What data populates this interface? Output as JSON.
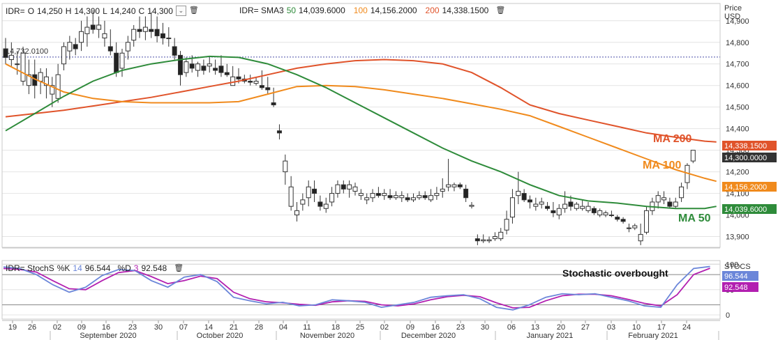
{
  "header": {
    "quote": {
      "ric": "IDR=",
      "o_label": "O",
      "o": "14,250",
      "h_label": "H",
      "h": "14,300",
      "l_label": "L",
      "l": "14,240",
      "c_label": "C",
      "c": "14,300"
    },
    "sma": {
      "label": "IDR= SMA3",
      "p1": "50",
      "v1": "14,039.6000",
      "p2": "100",
      "v2": "14,156.2000",
      "p3": "200",
      "v3": "14,338.1500"
    },
    "stoch": {
      "label": "IDR= StochS",
      "k_label": "%K",
      "k_period": "14",
      "k_val": "96.544",
      "d_label": "%D",
      "d_period": "3",
      "d_val": "92.548"
    }
  },
  "axis": {
    "price_title": "Price",
    "price_unit": "USD",
    "price_ticks": [
      "14,900",
      "14,800",
      "14,700",
      "14,600",
      "14,500",
      "14,400",
      "14,300",
      "14,200",
      "14,100",
      "14,000",
      "13,900"
    ],
    "stoch_title": "STOCS",
    "stoch_ticks": [
      "100",
      "50",
      "0"
    ],
    "day_labels": [
      "19",
      "26",
      "02",
      "09",
      "16",
      "23",
      "30",
      "07",
      "14",
      "21",
      "28",
      "04",
      "11",
      "18",
      "25",
      "02",
      "09",
      "16",
      "23",
      "30",
      "06",
      "13",
      "20",
      "27",
      "03",
      "10",
      "17",
      "24"
    ],
    "month_labels": [
      "September 2020",
      "October 2020",
      "November 2020",
      "December 2020",
      "January 2021",
      "February 2021"
    ]
  },
  "tags": {
    "ma200": "14,338.1500",
    "close": "14,300.0000",
    "ma100": "14,156.2000",
    "ma50": "14,039.6000",
    "k": "96.544",
    "d": "92.548"
  },
  "annotations": {
    "ma200": "MA 200",
    "ma100": "MA 100",
    "ma50": "MA 50",
    "stoch": "Stochastic overbought",
    "ref_label": "14,732.0100"
  },
  "colors": {
    "ma50": "#2e8b3a",
    "ma100": "#f08a1c",
    "ma200": "#e0532a",
    "k": "#6b86d9",
    "d": "#b21fb0",
    "close_tag": "#333333",
    "ref_line": "#4a4fa8"
  },
  "chart_data": {
    "type": "candlestick",
    "price_ylim": [
      13850,
      14980
    ],
    "reference_level": 14732,
    "candles": [
      [
        14770,
        14820,
        14700,
        14730
      ],
      [
        14720,
        14800,
        14690,
        14740
      ],
      [
        14700,
        14760,
        14650,
        14700
      ],
      [
        14620,
        14780,
        14600,
        14750
      ],
      [
        14600,
        14720,
        14560,
        14650
      ],
      [
        14650,
        14720,
        14540,
        14600
      ],
      [
        14620,
        14680,
        14560,
        14660
      ],
      [
        14600,
        14680,
        14540,
        14640
      ],
      [
        14560,
        14640,
        14500,
        14600
      ],
      [
        14540,
        14700,
        14520,
        14650
      ],
      [
        14700,
        14800,
        14670,
        14780
      ],
      [
        14760,
        14830,
        14720,
        14800
      ],
      [
        14790,
        14820,
        14740,
        14770
      ],
      [
        14800,
        14900,
        14760,
        14850
      ],
      [
        14840,
        14920,
        14780,
        14870
      ],
      [
        14880,
        14950,
        14840,
        14860
      ],
      [
        14860,
        14920,
        14820,
        14880
      ],
      [
        14820,
        14900,
        14780,
        14840
      ],
      [
        14780,
        14860,
        14740,
        14760
      ],
      [
        14750,
        14800,
        14640,
        14660
      ],
      [
        14680,
        14770,
        14640,
        14750
      ],
      [
        14760,
        14830,
        14720,
        14800
      ],
      [
        14810,
        14880,
        14780,
        14860
      ],
      [
        14860,
        14920,
        14820,
        14850
      ],
      [
        14850,
        14920,
        14810,
        14870
      ],
      [
        14860,
        14940,
        14820,
        14850
      ],
      [
        14860,
        14920,
        14800,
        14830
      ],
      [
        14840,
        14890,
        14790,
        14820
      ],
      [
        14820,
        14870,
        14780,
        14820
      ],
      [
        14780,
        14820,
        14720,
        14740
      ],
      [
        14740,
        14760,
        14600,
        14650
      ],
      [
        14660,
        14730,
        14640,
        14710
      ],
      [
        14700,
        14740,
        14660,
        14680
      ],
      [
        14670,
        14710,
        14640,
        14700
      ],
      [
        14690,
        14720,
        14650,
        14670
      ],
      [
        14690,
        14730,
        14660,
        14700
      ],
      [
        14680,
        14720,
        14650,
        14670
      ],
      [
        14690,
        14740,
        14640,
        14660
      ],
      [
        14660,
        14700,
        14640,
        14650
      ],
      [
        14600,
        14690,
        14600,
        14640
      ],
      [
        14640,
        14680,
        14610,
        14630
      ],
      [
        14630,
        14650,
        14610,
        14620
      ],
      [
        14620,
        14650,
        14600,
        14615
      ],
      [
        14610,
        14640,
        14600,
        14620
      ],
      [
        14600,
        14670,
        14580,
        14590
      ],
      [
        14590,
        14640,
        14560,
        14580
      ],
      [
        14520,
        14590,
        14500,
        14510
      ],
      [
        14390,
        14420,
        14350,
        14380
      ],
      [
        14200,
        14280,
        14140,
        14250
      ],
      [
        14040,
        14180,
        14020,
        14130
      ],
      [
        14000,
        14060,
        13970,
        14020
      ],
      [
        14050,
        14100,
        14020,
        14070
      ],
      [
        14080,
        14160,
        14040,
        14130
      ],
      [
        14120,
        14160,
        14060,
        14100
      ],
      [
        14060,
        14090,
        14020,
        14040
      ],
      [
        14030,
        14080,
        14010,
        14050
      ],
      [
        14060,
        14130,
        14040,
        14100
      ],
      [
        14100,
        14160,
        14080,
        14140
      ],
      [
        14140,
        14160,
        14100,
        14120
      ],
      [
        14120,
        14160,
        14080,
        14140
      ],
      [
        14110,
        14150,
        14090,
        14130
      ],
      [
        14090,
        14120,
        14070,
        14100
      ],
      [
        14070,
        14100,
        14050,
        14080
      ],
      [
        14080,
        14120,
        14060,
        14100
      ],
      [
        14100,
        14130,
        14080,
        14090
      ],
      [
        14090,
        14120,
        14070,
        14100
      ],
      [
        14090,
        14120,
        14070,
        14080
      ],
      [
        14080,
        14110,
        14070,
        14090
      ],
      [
        14080,
        14110,
        14060,
        14090
      ],
      [
        14080,
        14100,
        14060,
        14070
      ],
      [
        14070,
        14100,
        14060,
        14080
      ],
      [
        14080,
        14110,
        14070,
        14090
      ],
      [
        14090,
        14110,
        14070,
        14080
      ],
      [
        14070,
        14120,
        14060,
        14090
      ],
      [
        14090,
        14130,
        14070,
        14100
      ],
      [
        14110,
        14170,
        14080,
        14120
      ],
      [
        14130,
        14260,
        14110,
        14140
      ],
      [
        14130,
        14150,
        14110,
        14140
      ],
      [
        14140,
        14150,
        14120,
        14130
      ],
      [
        14120,
        14140,
        14060,
        14080
      ],
      [
        14040,
        14060,
        14030,
        14045
      ],
      [
        13890,
        13910,
        13860,
        13880
      ],
      [
        13880,
        13910,
        13870,
        13885
      ],
      [
        13880,
        13900,
        13870,
        13885
      ],
      [
        13890,
        13920,
        13880,
        13900
      ],
      [
        13890,
        13940,
        13880,
        13920
      ],
      [
        13930,
        14020,
        13910,
        13980
      ],
      [
        13990,
        14120,
        13960,
        14080
      ],
      [
        14090,
        14200,
        14050,
        14110
      ],
      [
        14100,
        14120,
        14060,
        14070
      ],
      [
        14070,
        14090,
        14030,
        14060
      ],
      [
        14040,
        14080,
        14020,
        14050
      ],
      [
        14050,
        14080,
        14030,
        14060
      ],
      [
        14040,
        14060,
        14020,
        14030
      ],
      [
        14020,
        14060,
        13990,
        14010
      ],
      [
        14000,
        14050,
        13980,
        14030
      ],
      [
        14030,
        14110,
        14010,
        14050
      ],
      [
        14060,
        14090,
        14020,
        14040
      ],
      [
        14030,
        14060,
        14020,
        14050
      ],
      [
        14030,
        14070,
        14020,
        14040
      ],
      [
        14020,
        14060,
        14010,
        14040
      ],
      [
        14030,
        14040,
        14000,
        14010
      ],
      [
        14000,
        14030,
        13990,
        14020
      ],
      [
        14000,
        14020,
        13990,
        14010
      ],
      [
        14000,
        14020,
        13990,
        14000
      ],
      [
        13990,
        14000,
        13970,
        13980
      ],
      [
        13980,
        13990,
        13960,
        13970
      ],
      [
        13940,
        13960,
        13920,
        13940
      ],
      [
        13940,
        13960,
        13930,
        13950
      ],
      [
        13880,
        13960,
        13860,
        13910
      ],
      [
        13920,
        14040,
        13910,
        14020
      ],
      [
        14020,
        14080,
        14000,
        14060
      ],
      [
        14060,
        14110,
        14030,
        14090
      ],
      [
        14070,
        14110,
        14050,
        14080
      ],
      [
        14060,
        14080,
        14030,
        14040
      ],
      [
        14040,
        14080,
        14030,
        14060
      ],
      [
        14080,
        14150,
        14060,
        14130
      ],
      [
        14150,
        14240,
        14120,
        14230
      ],
      [
        14250,
        14300,
        14240,
        14300
      ]
    ],
    "ma50": [
      [
        0,
        14390
      ],
      [
        5,
        14470
      ],
      [
        10,
        14550
      ],
      [
        15,
        14620
      ],
      [
        20,
        14670
      ],
      [
        25,
        14700
      ],
      [
        30,
        14720
      ],
      [
        35,
        14735
      ],
      [
        40,
        14730
      ],
      [
        45,
        14700
      ],
      [
        50,
        14650
      ],
      [
        55,
        14590
      ],
      [
        60,
        14520
      ],
      [
        65,
        14450
      ],
      [
        70,
        14380
      ],
      [
        75,
        14310
      ],
      [
        80,
        14250
      ],
      [
        85,
        14200
      ],
      [
        90,
        14140
      ],
      [
        95,
        14090
      ],
      [
        100,
        14065
      ],
      [
        105,
        14055
      ],
      [
        110,
        14040
      ],
      [
        115,
        14030
      ],
      [
        120,
        14030
      ],
      [
        122,
        14040
      ]
    ],
    "ma100": [
      [
        0,
        14700
      ],
      [
        5,
        14630
      ],
      [
        10,
        14570
      ],
      [
        15,
        14540
      ],
      [
        20,
        14525
      ],
      [
        25,
        14520
      ],
      [
        30,
        14520
      ],
      [
        35,
        14520
      ],
      [
        40,
        14525
      ],
      [
        45,
        14560
      ],
      [
        50,
        14595
      ],
      [
        55,
        14600
      ],
      [
        60,
        14595
      ],
      [
        65,
        14580
      ],
      [
        70,
        14560
      ],
      [
        75,
        14540
      ],
      [
        80,
        14515
      ],
      [
        85,
        14490
      ],
      [
        90,
        14460
      ],
      [
        95,
        14410
      ],
      [
        100,
        14360
      ],
      [
        105,
        14310
      ],
      [
        110,
        14260
      ],
      [
        115,
        14210
      ],
      [
        120,
        14170
      ],
      [
        122,
        14156
      ]
    ],
    "ma200": [
      [
        0,
        14455
      ],
      [
        5,
        14470
      ],
      [
        10,
        14485
      ],
      [
        15,
        14505
      ],
      [
        20,
        14525
      ],
      [
        25,
        14545
      ],
      [
        30,
        14570
      ],
      [
        35,
        14595
      ],
      [
        40,
        14620
      ],
      [
        45,
        14650
      ],
      [
        50,
        14680
      ],
      [
        55,
        14700
      ],
      [
        60,
        14715
      ],
      [
        65,
        14720
      ],
      [
        70,
        14715
      ],
      [
        75,
        14700
      ],
      [
        80,
        14660
      ],
      [
        85,
        14590
      ],
      [
        90,
        14510
      ],
      [
        95,
        14470
      ],
      [
        100,
        14440
      ],
      [
        105,
        14410
      ],
      [
        110,
        14380
      ],
      [
        115,
        14360
      ],
      [
        120,
        14342
      ],
      [
        122,
        14338
      ]
    ],
    "stoch_ylim": [
      0,
      105
    ],
    "stoch_levels": [
      80,
      20
    ],
    "k": [
      [
        0,
        95
      ],
      [
        3,
        92
      ],
      [
        6,
        80
      ],
      [
        9,
        60
      ],
      [
        12,
        45
      ],
      [
        15,
        55
      ],
      [
        18,
        78
      ],
      [
        21,
        90
      ],
      [
        24,
        88
      ],
      [
        27,
        68
      ],
      [
        30,
        55
      ],
      [
        33,
        75
      ],
      [
        36,
        80
      ],
      [
        39,
        66
      ],
      [
        42,
        35
      ],
      [
        45,
        28
      ],
      [
        48,
        22
      ],
      [
        51,
        25
      ],
      [
        54,
        18
      ],
      [
        57,
        20
      ],
      [
        60,
        30
      ],
      [
        63,
        28
      ],
      [
        66,
        25
      ],
      [
        69,
        15
      ],
      [
        72,
        20
      ],
      [
        75,
        25
      ],
      [
        78,
        35
      ],
      [
        81,
        38
      ],
      [
        84,
        40
      ],
      [
        87,
        32
      ],
      [
        90,
        15
      ],
      [
        93,
        10
      ],
      [
        96,
        20
      ],
      [
        99,
        35
      ],
      [
        102,
        42
      ],
      [
        105,
        40
      ],
      [
        108,
        42
      ],
      [
        111,
        35
      ],
      [
        114,
        28
      ],
      [
        117,
        18
      ],
      [
        120,
        15
      ],
      [
        123,
        60
      ],
      [
        126,
        92
      ],
      [
        129,
        96
      ]
    ],
    "d": [
      [
        0,
        92
      ],
      [
        3,
        90
      ],
      [
        6,
        85
      ],
      [
        9,
        68
      ],
      [
        12,
        52
      ],
      [
        15,
        50
      ],
      [
        18,
        68
      ],
      [
        21,
        84
      ],
      [
        24,
        88
      ],
      [
        27,
        76
      ],
      [
        30,
        62
      ],
      [
        33,
        68
      ],
      [
        36,
        77
      ],
      [
        39,
        72
      ],
      [
        42,
        45
      ],
      [
        45,
        32
      ],
      [
        48,
        26
      ],
      [
        51,
        24
      ],
      [
        54,
        21
      ],
      [
        57,
        19
      ],
      [
        60,
        26
      ],
      [
        63,
        28
      ],
      [
        66,
        27
      ],
      [
        69,
        20
      ],
      [
        72,
        18
      ],
      [
        75,
        22
      ],
      [
        78,
        30
      ],
      [
        81,
        36
      ],
      [
        84,
        39
      ],
      [
        87,
        36
      ],
      [
        90,
        24
      ],
      [
        93,
        14
      ],
      [
        96,
        15
      ],
      [
        99,
        28
      ],
      [
        102,
        38
      ],
      [
        105,
        41
      ],
      [
        108,
        41
      ],
      [
        111,
        38
      ],
      [
        114,
        31
      ],
      [
        117,
        23
      ],
      [
        120,
        18
      ],
      [
        123,
        40
      ],
      [
        126,
        80
      ],
      [
        129,
        92.5
      ]
    ]
  }
}
